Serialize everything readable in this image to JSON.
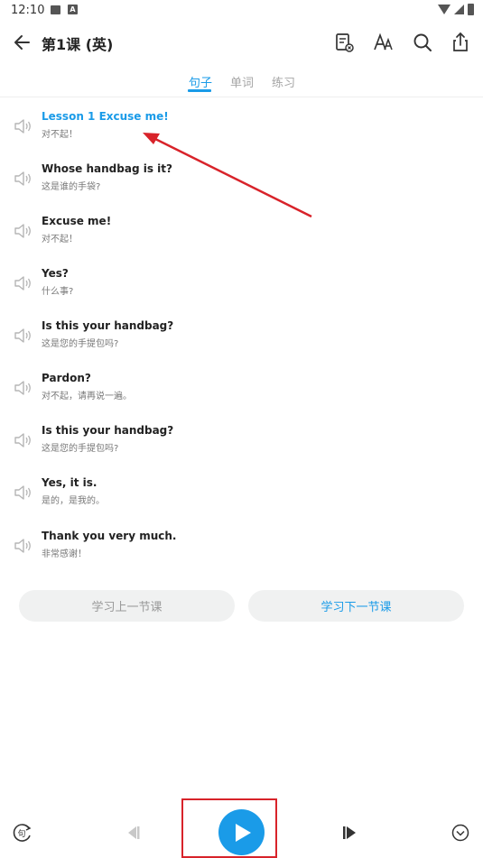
{
  "status_bar": {
    "time": "12:10"
  },
  "header": {
    "title": "第1课 (英)"
  },
  "tabs": [
    {
      "label": "句子",
      "active": true
    },
    {
      "label": "单词",
      "active": false
    },
    {
      "label": "练习",
      "active": false
    }
  ],
  "sentences": [
    {
      "en": "Lesson 1 Excuse me!",
      "zh": "对不起！",
      "active": true
    },
    {
      "en": "Whose handbag is it?",
      "zh": "这是谁的手袋?",
      "active": false
    },
    {
      "en": "Excuse me!",
      "zh": "对不起！",
      "active": false
    },
    {
      "en": "Yes?",
      "zh": "什么事?",
      "active": false
    },
    {
      "en": "Is this your handbag?",
      "zh": "这是您的手提包吗?",
      "active": false
    },
    {
      "en": "Pardon?",
      "zh": "对不起，请再说一遍。",
      "active": false
    },
    {
      "en": "Is this your handbag?",
      "zh": "这是您的手提包吗?",
      "active": false
    },
    {
      "en": "Yes, it is.",
      "zh": "是的，是我的。",
      "active": false
    },
    {
      "en": "Thank you very much.",
      "zh": "非常感谢！",
      "active": false
    }
  ],
  "lesson_nav": {
    "prev_label": "学习上一节课",
    "next_label": "学习下一节课"
  },
  "bottom_bar": {
    "sentence_mode_glyph": "句"
  },
  "colors": {
    "accent": "#1a9be8",
    "annotation": "#d8232a"
  },
  "icons": {
    "toolbar": [
      "notes-icon",
      "font-size-icon",
      "search-icon",
      "share-icon"
    ],
    "bottom": [
      "sentence-repeat-icon",
      "previous-icon",
      "play-icon",
      "next-icon",
      "expand-down-icon"
    ]
  }
}
